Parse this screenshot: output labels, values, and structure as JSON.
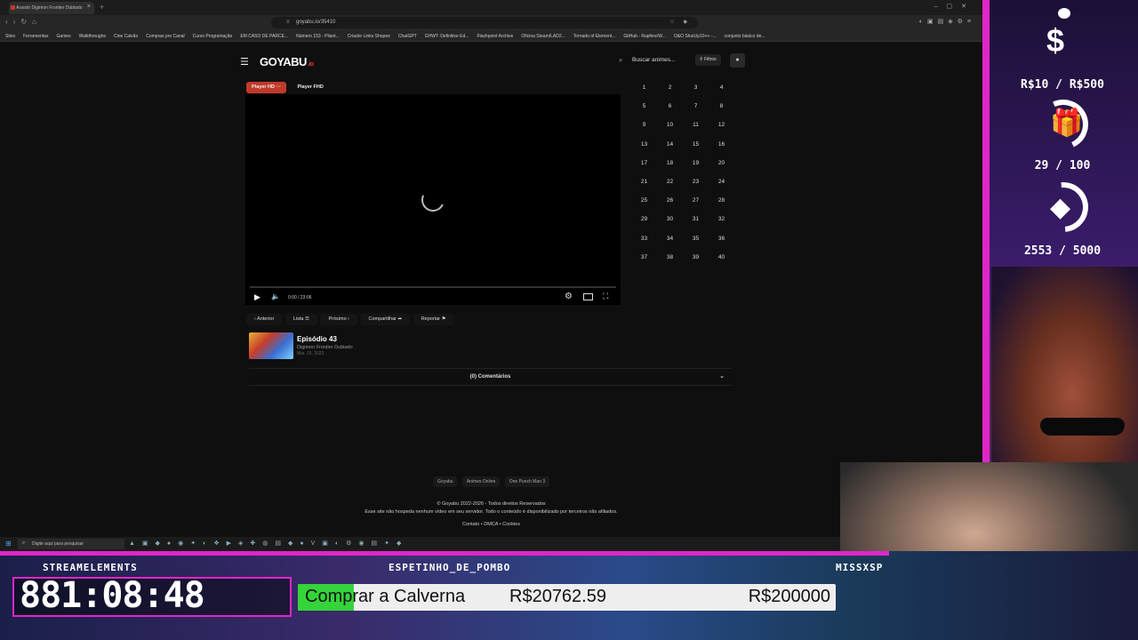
{
  "browser": {
    "tab_title": "Assistir Digimon Frontier Dublado",
    "url": "goyabu.io/35410",
    "bookmarks": [
      "Sites",
      "Ferramentas",
      "Games",
      "Walkthroughs",
      "Cine Calvão",
      "Compras pro Canal",
      "Curso Programação",
      "EM CASO DE PARCE...",
      "Número 153 - Pilant...",
      "Criador Links Shopee",
      "ChatGPT",
      "GHWT: Definitive Ed...",
      "Flashpoint Archive",
      "Oficina Steam/LAD2...",
      "Tornado of Element...",
      "GitHub - Raphire/W...",
      "O&O ShutUp10++ -...",
      "conjunto básico de..."
    ]
  },
  "site": {
    "logo": "GOYABU",
    "logo_sub": ".io",
    "search_placeholder": "Buscar animes...",
    "filter_label": "Filtros",
    "player_tabs": [
      {
        "label": "Player HD ···",
        "active": true
      },
      {
        "label": "Player FHD",
        "active": false
      }
    ],
    "video_time": "0:00 / 23:06",
    "episodes": [
      "1",
      "2",
      "3",
      "4",
      "5",
      "6",
      "7",
      "8",
      "9",
      "10",
      "11",
      "12",
      "13",
      "14",
      "15",
      "16",
      "17",
      "18",
      "19",
      "20",
      "21",
      "22",
      "23",
      "24",
      "25",
      "26",
      "27",
      "28",
      "29",
      "30",
      "31",
      "32",
      "33",
      "34",
      "35",
      "36",
      "37",
      "38",
      "39",
      "40"
    ],
    "actions": {
      "prev": "‹ Anterior",
      "list": "Lista ☰",
      "next": "Próximo ›",
      "share": "Compartilhar ➦",
      "report": "Reportar ⚑"
    },
    "episode_title": "Episódio 43",
    "anime_name": "Digimon Frontier Dublado",
    "episode_date": "Mai. 15, 2023",
    "comments_label": "(0) Comentários",
    "footer_links": [
      "Goyabu",
      "Animes Online",
      "One Punch Man 3"
    ],
    "copyright": "© Goyabu 2022-2026 - Todos direitos Reservados",
    "disclaimer": "Esse site não hospeda nenhum vídeo em seu servidor. Todo o conteúdo é disponibilizado por terceiros não afiliados.",
    "legal": "Contato  •  DMCA  •  Cookies"
  },
  "taskbar": {
    "search_placeholder": "Digite aqui para pesquisar"
  },
  "overlay": {
    "goal1": "R$10 / R$500",
    "goal2": "29 / 100",
    "goal3": "2553 / 5000",
    "label_left": "STREAMELEMENTS",
    "label_mid": "ESPETINHO_DE_POMBO",
    "label_right": "MISSXSP",
    "timer": "881:08:48",
    "goal_name": "Comprar a Calverna",
    "goal_current": "R$20762.59",
    "goal_target": "R$200000",
    "goal_progress": 0.104
  }
}
